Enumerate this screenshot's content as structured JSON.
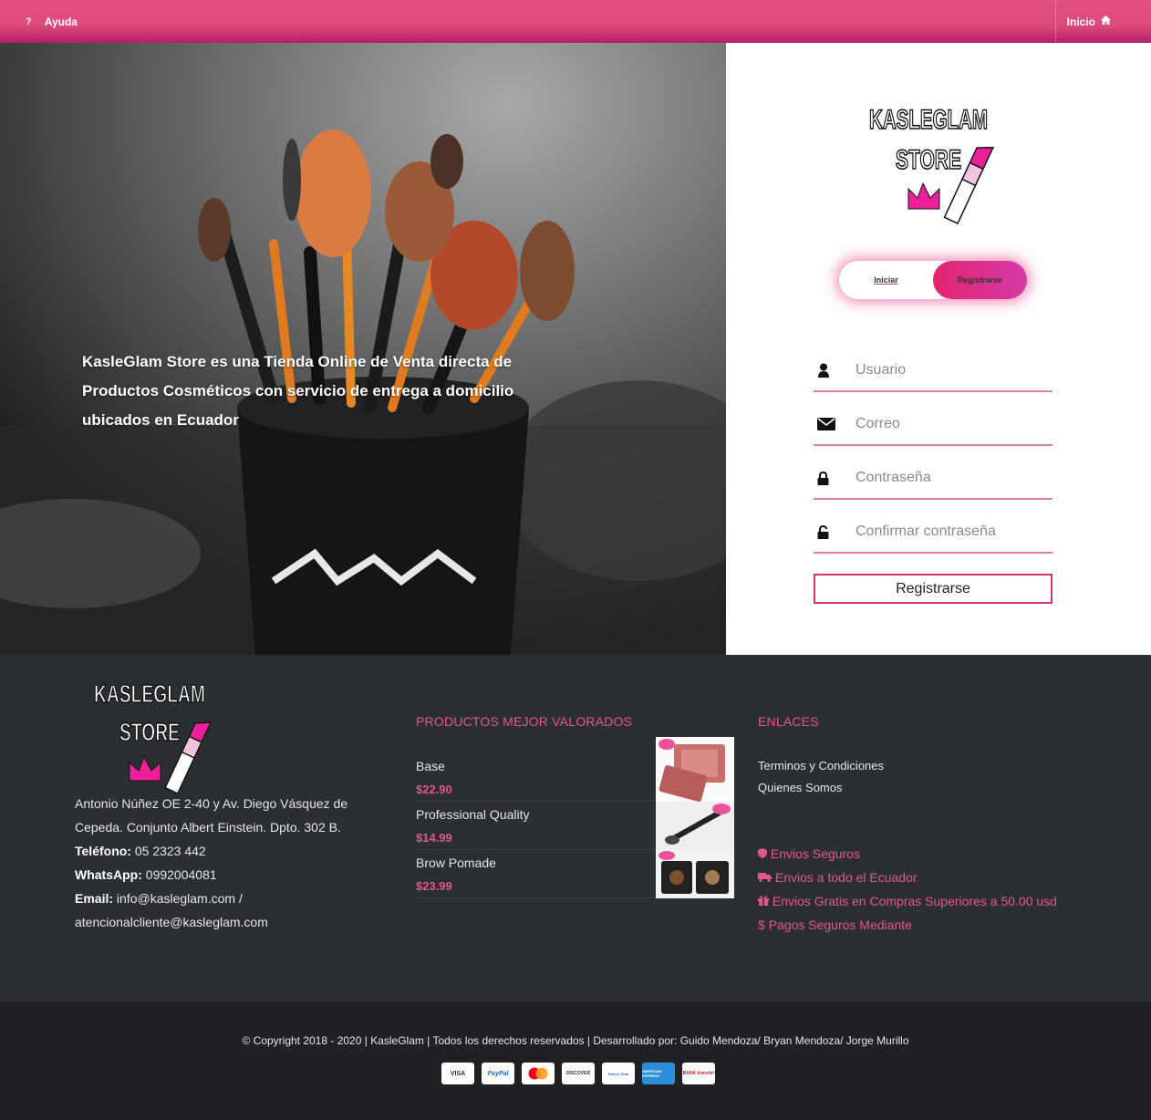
{
  "topbar": {
    "help_label": "Ayuda",
    "home_label": "Inicio"
  },
  "hero": {
    "text": "KasleGlam Store es una Tienda Online de Venta directa de Productos Cosméticos con servicio de entrega a domicilio ubicados en Ecuador"
  },
  "logo": {
    "line1": "KASLEGLAM",
    "line2": "STORE"
  },
  "register": {
    "tab_login": "Iniciar",
    "tab_register": "Registrarse",
    "fields": [
      {
        "icon": "user-icon",
        "placeholder": "Usuario"
      },
      {
        "icon": "envelope-icon",
        "placeholder": "Correo"
      },
      {
        "icon": "lock-icon",
        "placeholder": "Contraseña"
      },
      {
        "icon": "unlock-icon",
        "placeholder": "Confirmar contraseña"
      }
    ],
    "submit_label": "Registrarse"
  },
  "footer": {
    "address": "Antonio Núñez OE 2-40 y Av. Diego Vásquez de Cepeda. Conjunto Albert Einstein. Dpto. 302 B.",
    "phone_label": "Teléfono:",
    "phone": "05 2323 442",
    "whatsapp_label": "WhatsApp:",
    "whatsapp": "0992004081",
    "email_label": "Email:",
    "email": "info@kasleglam.com /",
    "email2": "atencionalcliente@kasleglam.com",
    "products_title": "PRODUCTOS MEJOR VALORADOS",
    "products": [
      {
        "name": "Base",
        "price": "$22.90"
      },
      {
        "name": "Professional Quality",
        "price": "$14.99"
      },
      {
        "name": "Brow Pomade",
        "price": "$23.99"
      }
    ],
    "links_title": "ENLACES",
    "links": [
      "Terminos y Condiciones",
      "Quienes Somos"
    ],
    "perks": [
      {
        "icon": "shield-icon",
        "label": "Envios Seguros"
      },
      {
        "icon": "truck-icon",
        "label": "Envios a todo el Ecuador"
      },
      {
        "icon": "gift-icon",
        "label": "Envios Gratis en Compras Superiores a 50.00 usd"
      },
      {
        "icon": "dollar-icon",
        "label": "Pagos Seguros Mediante"
      }
    ]
  },
  "bottom": {
    "copyright": "© Copyright 2018 - 2020   |  KasleGlam   |   Todos los derechos reservados   | Desarrollado por: Guido Mendoza/ Bryan Mendoza/ Jorge Murillo",
    "cards": [
      "VISA",
      "PayPal",
      "mastercard",
      "DISCOVER",
      "Diners Club",
      "AMERICAN EXPRESS",
      "BANK transfer"
    ]
  }
}
